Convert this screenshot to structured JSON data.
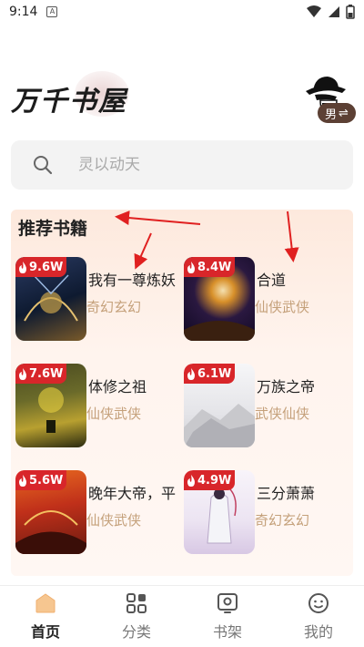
{
  "status_bar": {
    "time": "9:14",
    "notif_letter": "A"
  },
  "header": {
    "app_title": "万千书屋",
    "gender_badge": "男",
    "gender_swap_glyph": "⇌"
  },
  "search": {
    "placeholder": "灵以动天"
  },
  "recommend": {
    "title": "推荐书籍",
    "books": [
      {
        "title": "我有一尊炼妖",
        "tag": "奇幻玄幻",
        "heat": "9.6W",
        "cover": [
          "#1b2a4a",
          "#c9a24a"
        ]
      },
      {
        "title": "合道",
        "tag": "仙侠武侠",
        "heat": "8.4W",
        "cover": [
          "#1a1030",
          "#d85a20"
        ]
      },
      {
        "title": "体修之祖",
        "tag": "仙侠武侠",
        "heat": "7.6W",
        "cover": [
          "#3a3a1a",
          "#d8c040"
        ]
      },
      {
        "title": "万族之帝",
        "tag": "武侠仙侠",
        "heat": "6.1W",
        "cover": [
          "#e8e8ea",
          "#b8b8bc"
        ]
      },
      {
        "title": "晚年大帝，平",
        "tag": "仙侠武侠",
        "heat": "5.6W",
        "cover": [
          "#c0301a",
          "#f0a040"
        ]
      },
      {
        "title": "三分萧萧",
        "tag": "奇幻玄幻",
        "heat": "4.9W",
        "cover": [
          "#f4f0f6",
          "#c8b0d8"
        ]
      }
    ]
  },
  "bottom_nav": [
    {
      "label": "首页",
      "icon": "home-icon",
      "active": true
    },
    {
      "label": "分类",
      "icon": "grid-icon",
      "active": false
    },
    {
      "label": "书架",
      "icon": "bookshelf-icon",
      "active": false
    },
    {
      "label": "我的",
      "icon": "profile-icon",
      "active": false
    }
  ],
  "colors": {
    "accent": "#d8262a",
    "tag": "#c4a07a",
    "panel": "#fde9dd",
    "annotation": "#e02020"
  }
}
